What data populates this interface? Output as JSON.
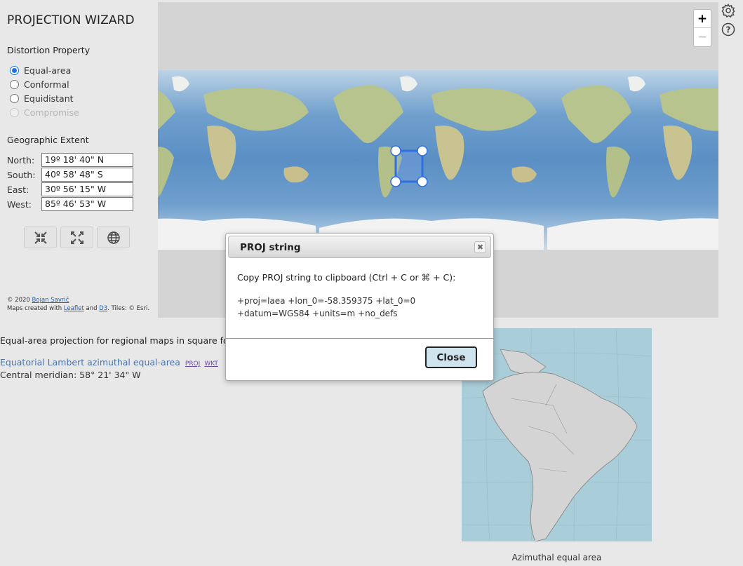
{
  "app": {
    "title": "PROJECTION WIZARD"
  },
  "sidebar": {
    "distortion_title": "Distortion Property",
    "distortion_options": [
      {
        "label": "Equal-area",
        "checked": true,
        "disabled": false
      },
      {
        "label": "Conformal",
        "checked": false,
        "disabled": false
      },
      {
        "label": "Equidistant",
        "checked": false,
        "disabled": false
      },
      {
        "label": "Compromise",
        "checked": false,
        "disabled": true
      }
    ],
    "extent_title": "Geographic Extent",
    "extent": [
      {
        "label": "North:",
        "value": "19º 18' 40\" N"
      },
      {
        "label": "South:",
        "value": "40º 58' 48\" S"
      },
      {
        "label": "East:",
        "value": "30º 56' 15\" W"
      },
      {
        "label": "West:",
        "value": "85º 46' 53\" W"
      }
    ],
    "tool_icons": [
      "shrink-icon",
      "expand-icon",
      "globe-icon"
    ],
    "credits": {
      "line1_prefix": "© 2020 ",
      "author": "Bojan Savrič",
      "line2_prefix": "Maps created with ",
      "leaflet": "Leaflet",
      "and": " and ",
      "d3": "D3",
      "tiles": ". Tiles: © Esri."
    }
  },
  "map": {
    "zoom_in": "+",
    "zoom_out": "−"
  },
  "content": {
    "description": "Equal-area projection for regional maps in square for",
    "projection_name": "Equatorial Lambert azimuthal equal-area",
    "proj_link": "PROJ",
    "wkt_link": "WKT",
    "central_meridian": "Central meridian: 58° 21' 34\" W",
    "preview_caption": "Azimuthal equal area"
  },
  "dialog": {
    "title": "PROJ string",
    "close_x": "✖",
    "instruction": "Copy PROJ string to clipboard (Ctrl + C or ⌘ + C):",
    "proj_string": "+proj=laea +lon_0=-58.359375 +lat_0=0 +datum=WGS84 +units=m +no_defs",
    "close_button": "Close"
  },
  "colors": {
    "accent": "#1a73e8",
    "link": "#4a73a8",
    "close_button_bg": "#cfe3ec"
  }
}
